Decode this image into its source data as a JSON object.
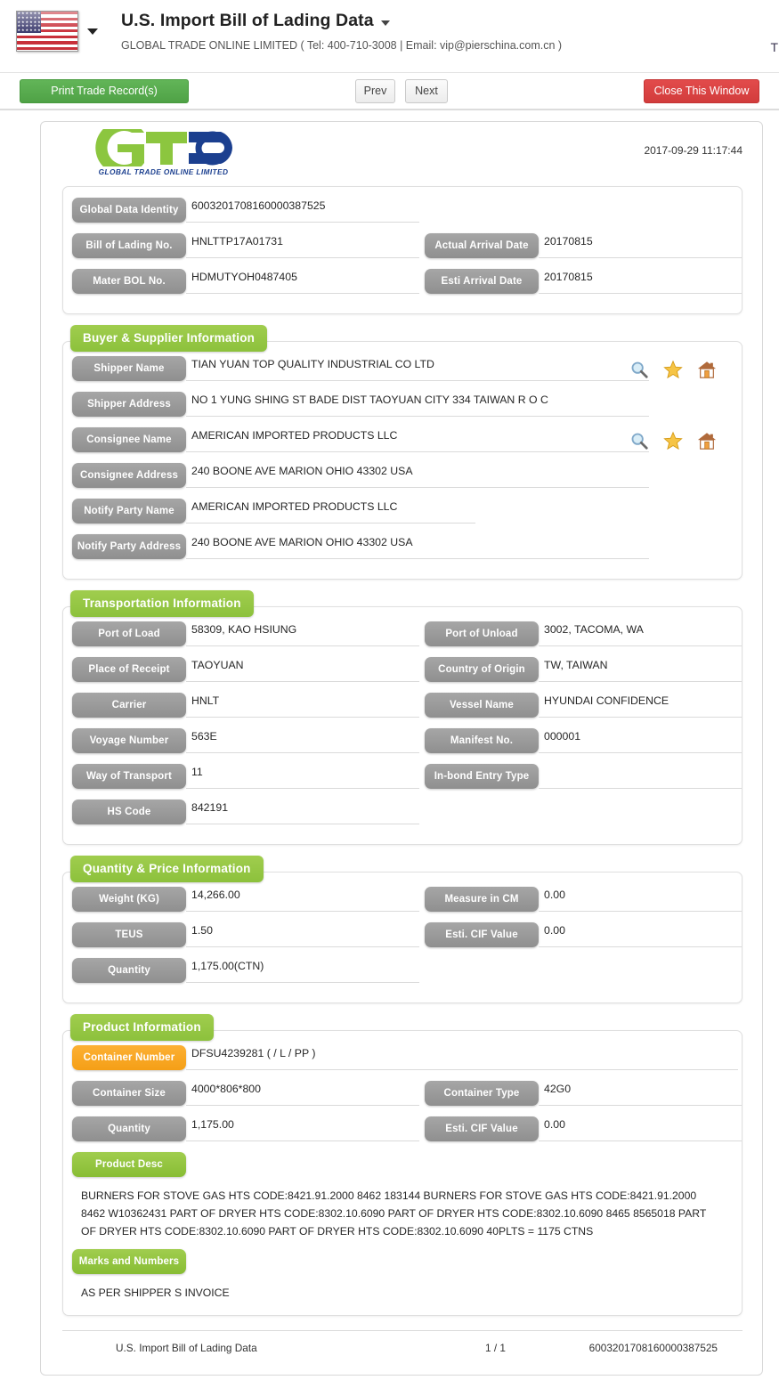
{
  "header": {
    "flag_icon": "us-flag-icon",
    "flag_caret_icon": "chevron-down-icon",
    "title": "U.S. Import Bill of Lading Data",
    "title_caret_icon": "chevron-down-icon",
    "subtitle": "GLOBAL TRADE ONLINE LIMITED ( Tel: 400-710-3008 | Email: vip@pierschina.com.cn )",
    "edge_char": "T"
  },
  "toolbar": {
    "print_label": "Print Trade Record(s)",
    "prev_label": "Prev",
    "next_label": "Next",
    "close_label": "Close This Window",
    "print_color": "#4fa246",
    "close_color": "#d23c3c"
  },
  "document": {
    "logo_text": "GLOBAL TRADE  ONLINE LIMITED",
    "logo_green": "#8cc63f",
    "logo_blue": "#1b3f8f",
    "generated_time": "2017-09-29 11:17:44"
  },
  "identity": {
    "fields": [
      {
        "label": "Global Data Identity",
        "value": "6003201708160000387525"
      },
      {
        "label": "Bill of Lading No.",
        "value": "HNLTTP17A01731"
      },
      {
        "label": "Mater BOL No.",
        "value": "HDMUTYOH0487405"
      }
    ],
    "right_fields": [
      {
        "label": "Actual Arrival Date",
        "value": "20170815"
      },
      {
        "label": "Esti Arrival Date",
        "value": "20170815"
      }
    ]
  },
  "buyer_supplier": {
    "tab_label": "Buyer & Supplier Information",
    "fields": [
      {
        "label": "Shipper Name",
        "value": "TIAN YUAN TOP QUALITY INDUSTRIAL CO LTD"
      },
      {
        "label": "Shipper Address",
        "value": "NO 1 YUNG SHING ST BADE DIST TAOYUAN CITY 334 TAIWAN R O C"
      },
      {
        "label": "Consignee Name",
        "value": "AMERICAN IMPORTED PRODUCTS LLC"
      },
      {
        "label": "Consignee Address",
        "value": "240 BOONE AVE MARION OHIO 43302 USA"
      },
      {
        "label": "Notify Party Name",
        "value": "AMERICAN IMPORTED PRODUCTS LLC"
      },
      {
        "label": "Notify Party Address",
        "value": "240 BOONE AVE MARION OHIO 43302 USA"
      }
    ],
    "icons": [
      "search-icon",
      "star-icon",
      "home-icon"
    ]
  },
  "transportation": {
    "tab_label": "Transportation Information",
    "left_fields": [
      {
        "label": "Port of Load",
        "value": "58309, KAO HSIUNG"
      },
      {
        "label": "Place of Receipt",
        "value": "TAOYUAN"
      },
      {
        "label": "Carrier",
        "value": "HNLT"
      },
      {
        "label": "Voyage Number",
        "value": "563E"
      },
      {
        "label": "Way of Transport",
        "value": "11"
      },
      {
        "label": "HS Code",
        "value": "842191"
      }
    ],
    "right_fields": [
      {
        "label": "Port of Unload",
        "value": "3002, TACOMA, WA"
      },
      {
        "label": "Country of Origin",
        "value": "TW, TAIWAN"
      },
      {
        "label": "Vessel Name",
        "value": "HYUNDAI CONFIDENCE"
      },
      {
        "label": "Manifest No.",
        "value": "000001"
      },
      {
        "label": "In-bond Entry Type",
        "value": ""
      }
    ]
  },
  "quantity_price": {
    "tab_label": "Quantity & Price Information",
    "left_fields": [
      {
        "label": "Weight (KG)",
        "value": "14,266.00"
      },
      {
        "label": "TEUS",
        "value": "1.50"
      },
      {
        "label": "Quantity",
        "value": "1,175.00(CTN)"
      }
    ],
    "right_fields": [
      {
        "label": "Measure in CM",
        "value": "0.00"
      },
      {
        "label": "Esti. CIF Value",
        "value": "0.00"
      }
    ]
  },
  "product": {
    "tab_label": "Product Information",
    "container_number": {
      "label": "Container Number",
      "value": "DFSU4239281 ( / L / PP )",
      "color": "#f5a623"
    },
    "left_fields": [
      {
        "label": "Container Size",
        "value": "4000*806*800"
      },
      {
        "label": "Quantity",
        "value": "1,175.00"
      }
    ],
    "right_fields": [
      {
        "label": "Container Type",
        "value": "42G0"
      },
      {
        "label": "Esti. CIF Value",
        "value": "0.00"
      }
    ],
    "product_desc_label": "Product Desc",
    "product_desc": "BURNERS FOR STOVE GAS HTS CODE:8421.91.2000 8462 183144 BURNERS FOR STOVE GAS HTS CODE:8421.91.2000 8462 W10362431 PART OF DRYER HTS CODE:8302.10.6090 PART OF DRYER HTS CODE:8302.10.6090 8465 8565018 PART OF DRYER HTS CODE:8302.10.6090 PART OF DRYER HTS CODE:8302.10.6090 40PLTS = 1175 CTNS",
    "marks_label": "Marks and Numbers",
    "marks_value": "AS PER SHIPPER S INVOICE"
  },
  "footer": {
    "left": "U.S. Import Bill of Lading Data",
    "center": "1 / 1",
    "right": "6003201708160000387525"
  }
}
